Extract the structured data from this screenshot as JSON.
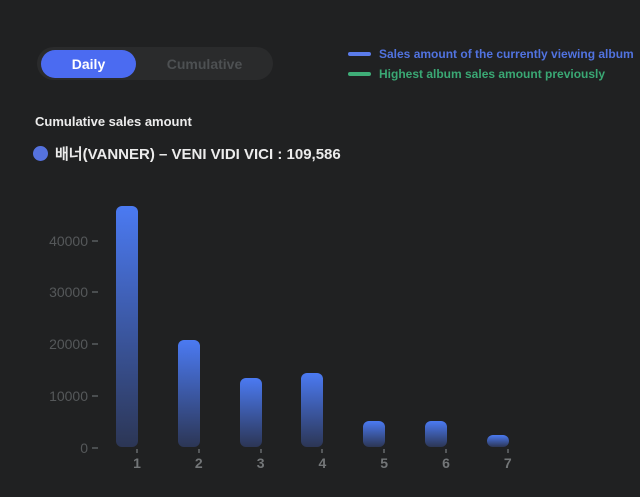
{
  "toggle": {
    "daily_label": "Daily",
    "cumulative_label": "Cumulative",
    "active": "Daily"
  },
  "legend": {
    "items": [
      {
        "label": "Sales amount of the currently viewing album",
        "color": "#5b7ceb",
        "text_color": "#5173e0"
      },
      {
        "label": "Highest album sales amount previously",
        "color": "#3fae78",
        "text_color": "#3aa874"
      }
    ]
  },
  "album": {
    "label": "배너(VANNER) – VENI VIDI VICI : 109,586",
    "marker_color": "#5572de"
  },
  "colors": {
    "background": "#202122",
    "accent_blue": "#4b6bf1",
    "toggle_track": "#2a2b2c"
  },
  "chart_data": {
    "type": "bar",
    "title": "Cumulative sales amount",
    "categories": [
      "1",
      "2",
      "3",
      "4",
      "5",
      "6",
      "7"
    ],
    "values": [
      46700,
      20800,
      13400,
      14500,
      5100,
      5100,
      2500
    ],
    "xlabel": "",
    "ylabel": "",
    "y_ticks": [
      0,
      10000,
      20000,
      30000,
      40000
    ],
    "y_tick_labels": [
      "0",
      "10000",
      "20000",
      "30000",
      "40000"
    ],
    "ylim": [
      0,
      47000
    ],
    "grid": false,
    "legend_position": "top-right",
    "bar_color_top": "#4b7af2",
    "bar_color_bottom": "#2c3655"
  }
}
